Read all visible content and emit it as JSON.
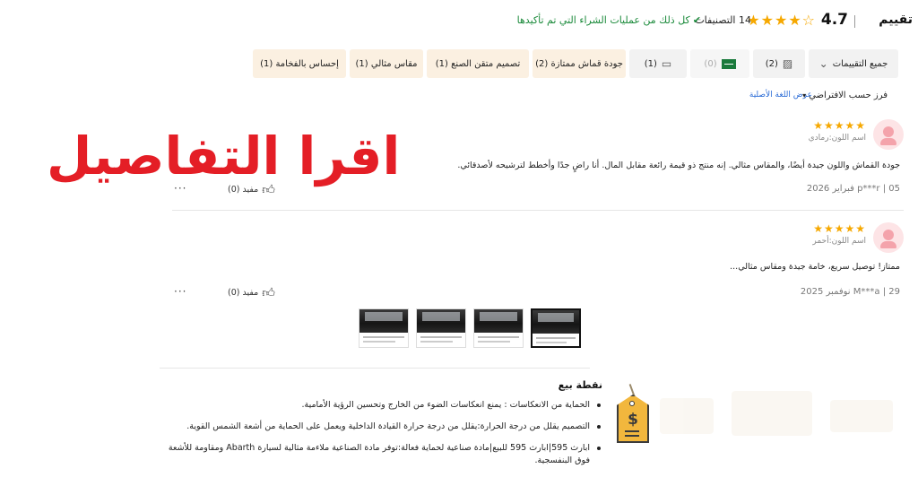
{
  "header": {
    "title": "تقييم",
    "score": "4.7",
    "stars": "★★★★☆",
    "count": "14 التصنيفات",
    "verified_text": "كل ذلك من عمليات الشراء التي تم تأكيدها"
  },
  "filters": {
    "all_label": "جميع التقييمات",
    "photos_count": "(2)",
    "flag_count": "(0)",
    "comments_count": "(1)",
    "chips": [
      "جودة قماش ممتازة (2)",
      "تصميم متقن الصنع (1)",
      "مقاس مثالي (1)",
      "إحساس بالفخامة (1)"
    ]
  },
  "sort": {
    "label": "فرز حسب الافتراضي",
    "original_language": "عرض اللغة الأصلية"
  },
  "reviews": [
    {
      "stars": "★★★★★",
      "color": "اسم اللون:رمادي",
      "text": "جودة القماش واللون جيدة أيضًا، والمقاس مثالي. إنه منتج ذو قيمة رائعة مقابل المال. أنا راضٍ جدًا وأخطط لترشيحه لأصدقائي.",
      "meta": "05 | p***r فبراير 2026",
      "helpful": "مفيد (0)",
      "more": "···"
    },
    {
      "stars": "★★★★★",
      "color": "اسم اللون:أحمر",
      "text": "ممتاز! توصيل سريع، خامة جيدة ومقاس مثالي...",
      "meta": "29 | M***a نوفمبر 2025",
      "helpful": "مفيد (0)",
      "more": "···"
    }
  ],
  "overlay_text": "اقرا التفاصيل",
  "selling": {
    "heading": "نقطة بيع",
    "bullets": [
      "الحماية من الانعكاسات : يمنع انعكاسات الضوء من الخارج وتحسين الرؤية الأمامية.",
      "التصميم يقلل من درجة الحرارة:يقلل من درجة حرارة القيادة الداخلية ويعمل على الحماية من أشعة الشمس القوية.",
      "ابارث 595|ابارث 595 للبيع|مادة صناعية لحماية فعالة:توفر مادة الصناعية ملاءمة مثالية لسيارة Abarth ومقاومة للأشعة فوق البنفسجية."
    ]
  },
  "colors": {
    "star": "#f6a800",
    "verified": "#1a8a3a",
    "link": "#2a6bd6",
    "overlay": "#e41e26",
    "tag": "#f2b73d"
  }
}
